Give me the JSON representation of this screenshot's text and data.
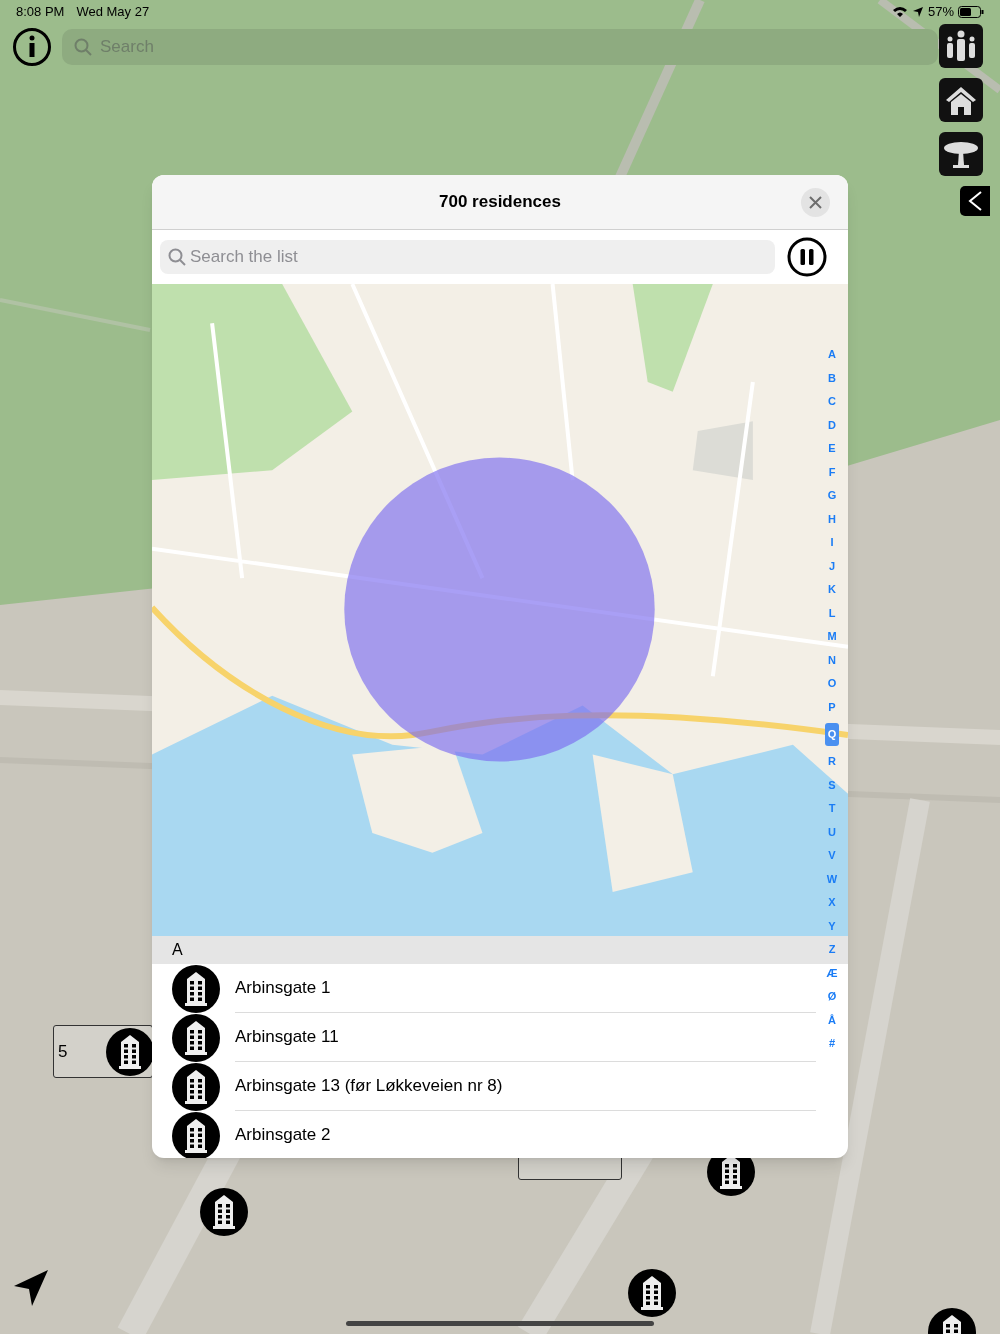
{
  "status_bar": {
    "time": "8:08 PM",
    "date": "Wed May 27",
    "battery": "57%"
  },
  "search": {
    "placeholder": "Search"
  },
  "map_callout": {
    "label": "5"
  },
  "sheet": {
    "title": "700 residences",
    "search": {
      "placeholder": "Search the list"
    },
    "playing": true,
    "section": "A",
    "rows": [
      {
        "name": "Arbinsgate 1"
      },
      {
        "name": "Arbinsgate 11"
      },
      {
        "name": "Arbinsgate 13 (før Løkkeveien nr 8)"
      },
      {
        "name": "Arbinsgate 2"
      }
    ],
    "index": [
      {
        "label": "A",
        "selected": false
      },
      {
        "label": "B",
        "selected": false
      },
      {
        "label": "C",
        "selected": false
      },
      {
        "label": "D",
        "selected": false
      },
      {
        "label": "E",
        "selected": false
      },
      {
        "label": "F",
        "selected": false
      },
      {
        "label": "G",
        "selected": false
      },
      {
        "label": "H",
        "selected": false
      },
      {
        "label": "I",
        "selected": false
      },
      {
        "label": "J",
        "selected": false
      },
      {
        "label": "K",
        "selected": false
      },
      {
        "label": "L",
        "selected": false
      },
      {
        "label": "M",
        "selected": false
      },
      {
        "label": "N",
        "selected": false
      },
      {
        "label": "O",
        "selected": false
      },
      {
        "label": "P",
        "selected": false
      },
      {
        "label": "Q",
        "selected": true
      },
      {
        "label": "R",
        "selected": false
      },
      {
        "label": "S",
        "selected": false
      },
      {
        "label": "T",
        "selected": false
      },
      {
        "label": "U",
        "selected": false
      },
      {
        "label": "V",
        "selected": false
      },
      {
        "label": "W",
        "selected": false
      },
      {
        "label": "X",
        "selected": false
      },
      {
        "label": "Y",
        "selected": false
      },
      {
        "label": "Z",
        "selected": false
      },
      {
        "label": "Æ",
        "selected": false
      },
      {
        "label": "Ø",
        "selected": false
      },
      {
        "label": "Å",
        "selected": false
      },
      {
        "label": "#",
        "selected": false
      }
    ]
  }
}
